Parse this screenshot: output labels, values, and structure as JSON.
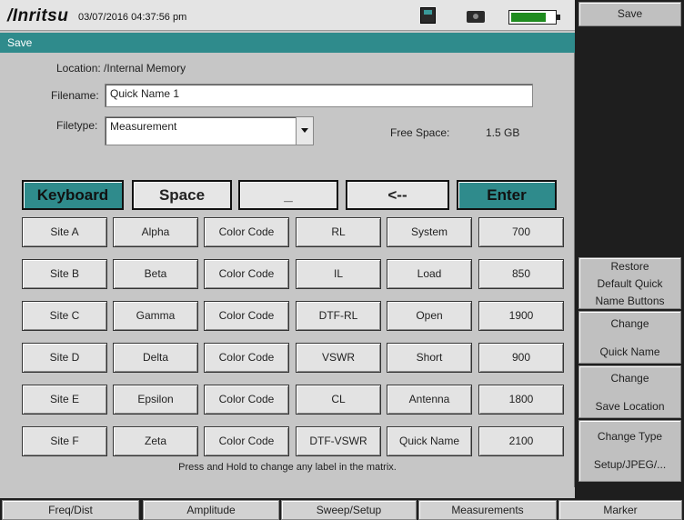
{
  "status_bar": {
    "logo": "/Inritsu",
    "datetime": "03/07/2016 04:37:56 pm",
    "icons": [
      "floppy-disk-icon",
      "camera-icon",
      "battery-icon"
    ],
    "battery_level": 0.8
  },
  "dialog": {
    "title": "Save",
    "location": "Location: /Internal Memory",
    "filename_label": "Filename:",
    "filename_value": "Quick Name 1",
    "filetype_label": "Filetype:",
    "filetype_value": "Measurement",
    "free_space_label": "Free Space:",
    "free_space_value": "1.5 GB"
  },
  "keyboard_row": {
    "keyboard": "Keyboard",
    "space": "Space",
    "underscore": "_",
    "backspace": "<--",
    "enter": "Enter"
  },
  "matrix": [
    [
      "Site A",
      "Alpha",
      "Color Code",
      "RL",
      "System",
      "700"
    ],
    [
      "Site B",
      "Beta",
      "Color Code",
      "IL",
      "Load",
      "850"
    ],
    [
      "Site C",
      "Gamma",
      "Color Code",
      "DTF-RL",
      "Open",
      "1900"
    ],
    [
      "Site D",
      "Delta",
      "Color Code",
      "VSWR",
      "Short",
      "900"
    ],
    [
      "Site E",
      "Epsilon",
      "Color Code",
      "CL",
      "Antenna",
      "1800"
    ],
    [
      "Site F",
      "Zeta",
      "Color Code",
      "DTF-VSWR",
      "Quick Name",
      "2100"
    ]
  ],
  "hint": "Press and Hold to change any label in the matrix.",
  "right_menu": {
    "title": "Save",
    "restore": [
      "Restore",
      "Default Quick",
      "Name Buttons"
    ],
    "change_quick_name": [
      "Change",
      "Quick Name"
    ],
    "change_save_location": [
      "Change",
      "Save Location"
    ],
    "change_type": [
      "Change Type",
      "Setup/JPEG/..."
    ]
  },
  "bottom_menu": [
    "Freq/Dist",
    "Amplitude",
    "Sweep/Setup",
    "Measurements",
    "Marker"
  ],
  "colors": {
    "accent": "#2f8b8c",
    "panel": "#c6c6c6",
    "dark": "#1e1e1e"
  }
}
